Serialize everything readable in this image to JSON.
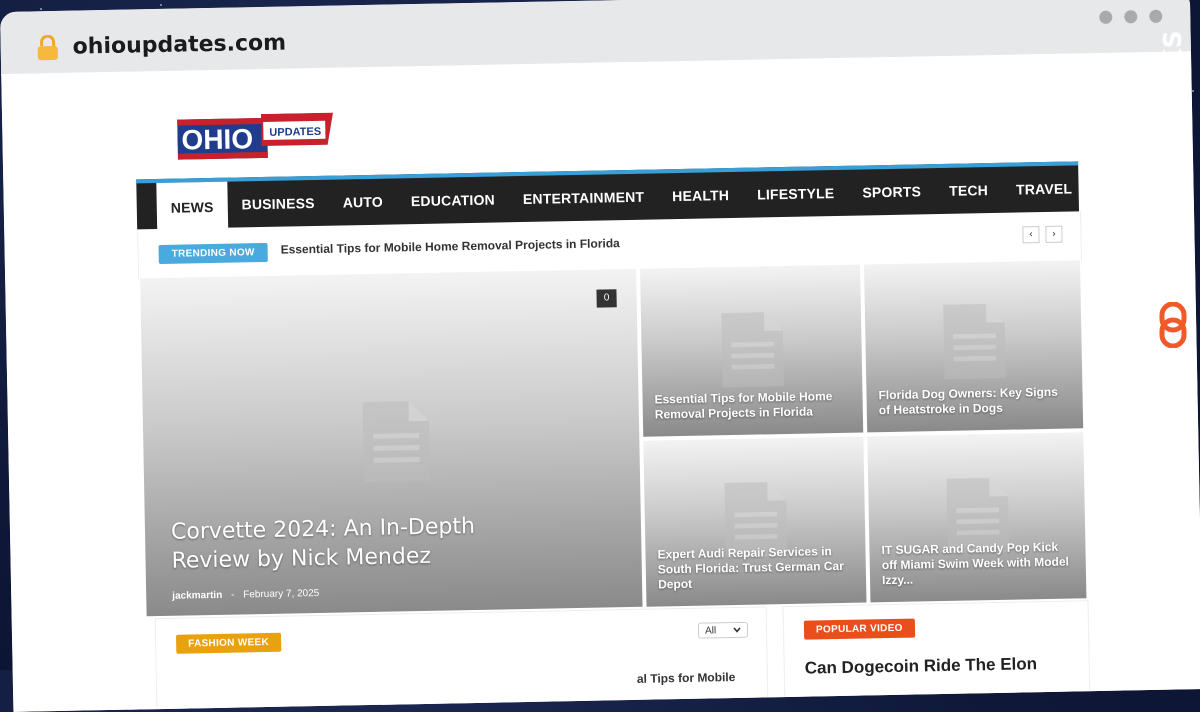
{
  "browser": {
    "url": "ohioupdates.com"
  },
  "site": {
    "logo_main": "OHIO",
    "logo_sub": "UPDATES"
  },
  "nav": {
    "items": [
      "NEWS",
      "BUSINESS",
      "AUTO",
      "EDUCATION",
      "ENTERTAINMENT",
      "HEALTH",
      "LIFESTYLE",
      "SPORTS",
      "TECH",
      "TRAVEL"
    ],
    "active": "NEWS"
  },
  "trending": {
    "badge": "TRENDING NOW",
    "headline": "Essential Tips for Mobile Home Removal Projects in Florida",
    "prev": "‹",
    "next": "›"
  },
  "hero": {
    "main": {
      "title": "Corvette 2024: An In-Depth Review by Nick Mendez",
      "author": "jackmartin",
      "separator": "-",
      "date": "February 7, 2025",
      "comments": "0"
    },
    "tiles": [
      {
        "title": "Essential Tips for Mobile Home Removal Projects in Florida"
      },
      {
        "title": "Florida Dog Owners: Key Signs of Heatstroke in Dogs"
      },
      {
        "title": "Expert Audi Repair Services in South Florida: Trust German Car Depot"
      },
      {
        "title": "IT SUGAR and Candy Pop Kick off Miami Swim Week with Model Izzy..."
      }
    ]
  },
  "sections": {
    "fashion_tag": "FASHION WEEK",
    "filter_value": "All",
    "peek_text": "al Tips for Mobile",
    "video_tag": "POPULAR VIDEO",
    "video_title": "Can Dogecoin Ride The Elon"
  },
  "watermark": {
    "text": "GUESTPOSTLINKS"
  },
  "colors": {
    "nav_accent": "#3a9fd6",
    "trending": "#4aa9dd",
    "fashion": "#e9a20f",
    "video": "#e94e1b",
    "watermark_icon": "#f05a28"
  }
}
